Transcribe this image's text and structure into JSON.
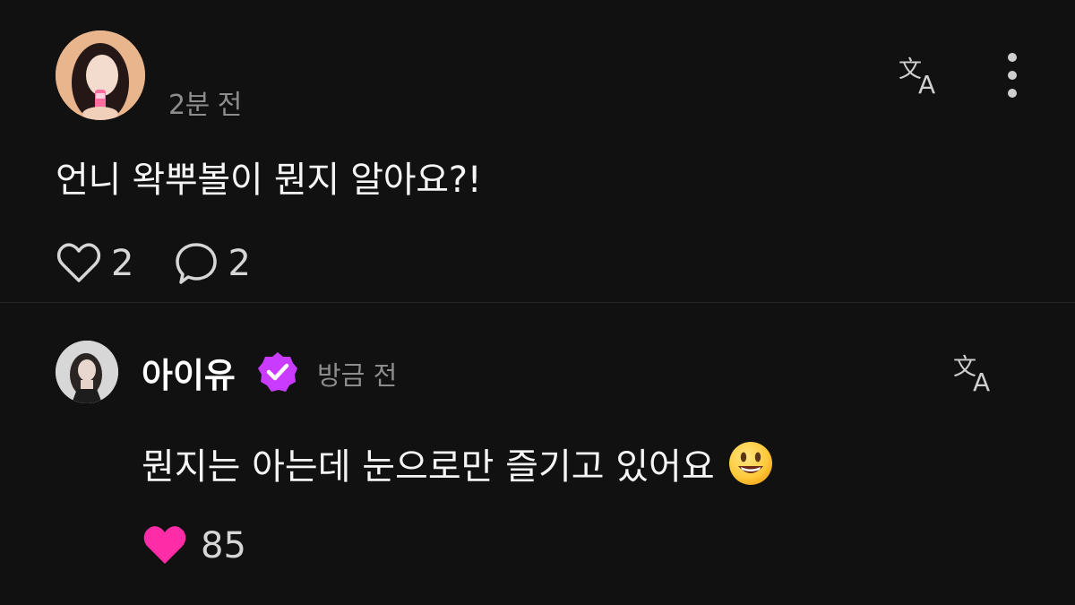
{
  "comment": {
    "time": "2분 전",
    "text": "언니 왁뿌볼이 뭔지 알아요?!",
    "like_count": "2",
    "reply_count": "2"
  },
  "reply": {
    "username": "아이유",
    "time": "방금 전",
    "text": "뭔지는 아는데 눈으로만 즐기고 있어요",
    "like_count": "85"
  },
  "icons": {
    "translate": "translate-icon",
    "more": "more-vertical-icon",
    "like": "heart-outline-icon",
    "reply": "speech-bubble-icon",
    "verified": "verified-badge-icon",
    "liked": "heart-filled-icon",
    "emoji": "smiling-face-icon"
  },
  "colors": {
    "background": "#111112",
    "liked_heart": "#ff2ca8",
    "verified_badge": "#c93cff",
    "muted_text": "#8d8d8d"
  }
}
